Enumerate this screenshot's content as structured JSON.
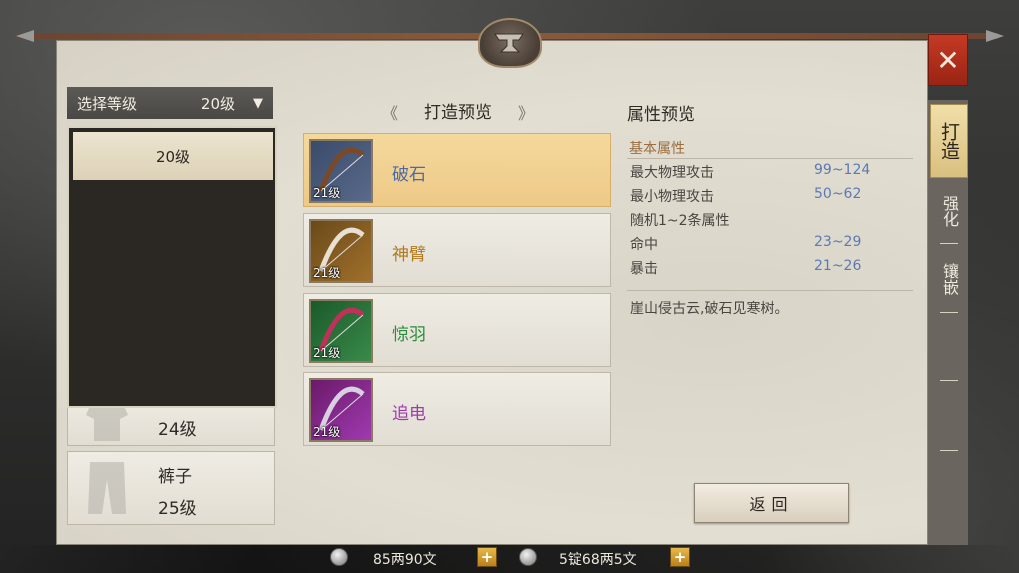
{
  "level_selector": {
    "label": "选择等级",
    "value": "20级",
    "dropdown_options": [
      "20级"
    ]
  },
  "equipment_list": [
    {
      "name": "",
      "level": "24级",
      "icon": "shirt-icon"
    },
    {
      "name": "裤子",
      "level": "25级",
      "icon": "pants-icon"
    }
  ],
  "forge_preview": {
    "title": "打造预览",
    "items": [
      {
        "name": "破石",
        "level": "21级",
        "name_color": "#4a6aa8",
        "selected": true,
        "icon": "bow-icon"
      },
      {
        "name": "神臂",
        "level": "21级",
        "name_color": "#b0781c",
        "selected": false,
        "icon": "bow-icon"
      },
      {
        "name": "惊羽",
        "level": "21级",
        "name_color": "#2e8a3c",
        "selected": false,
        "icon": "bow-icon"
      },
      {
        "name": "追电",
        "level": "21级",
        "name_color": "#a03ab0",
        "selected": false,
        "icon": "bow-icon"
      }
    ]
  },
  "attributes": {
    "title": "属性预览",
    "section": "基本属性",
    "rows": [
      {
        "label": "最大物理攻击",
        "value": "99~124"
      },
      {
        "label": "最小物理攻击",
        "value": "50~62"
      },
      {
        "label": "随机1~2条属性",
        "value": ""
      },
      {
        "label": "命中",
        "value": "23~29"
      },
      {
        "label": "暴击",
        "value": "21~26"
      }
    ],
    "description": "崖山侵古云,破石见寒树。"
  },
  "buttons": {
    "return": "返回"
  },
  "tabs": [
    {
      "label": "打造",
      "active": true
    },
    {
      "label": "强化",
      "active": false
    },
    {
      "label": "镶嵌",
      "active": false
    }
  ],
  "currency": {
    "silver": "85两90文",
    "bound_silver": "5锭68两5文"
  },
  "colors": {
    "accent": "#f4d99c",
    "close": "#c43a24",
    "attr_value": "#5a7ab2"
  }
}
